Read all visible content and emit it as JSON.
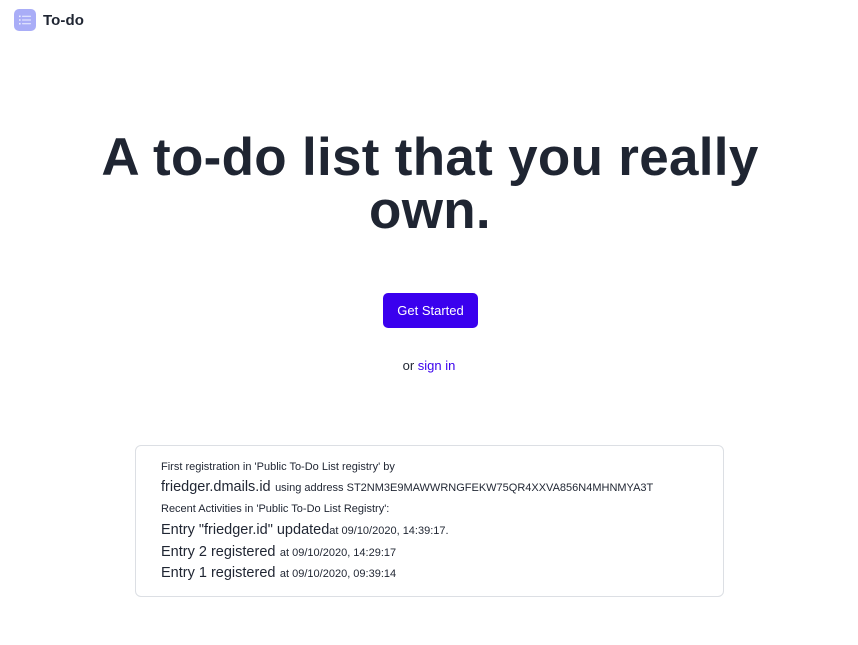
{
  "header": {
    "logo_icon": "list-icon",
    "title": "To-do"
  },
  "hero": {
    "title_line1": "A to-do list that you really",
    "title_line2": "own.",
    "cta_label": "Get Started",
    "signin_prefix": "or",
    "signin_link": "sign in"
  },
  "colors": {
    "accent": "#3a00ee",
    "logo_badge": "#a9adf7",
    "text": "#1f2532",
    "card_border": "#dcdfe4"
  },
  "registry": {
    "first_registration_label": "First registration in 'Public To-Do List registry' by",
    "owner_name": "friedger.dmails.id",
    "owner_address_text": "using address ST2NM3E9MAWWRNGFEKW75QR4XXVA856N4MHNMYA3T",
    "recent_label": "Recent Activities in 'Public To-Do List Registry':",
    "activities": [
      {
        "title": "Entry \"friedger.id\" updated",
        "time": "at 09/10/2020, 14:39:17."
      },
      {
        "title": "Entry 2 registered",
        "time": "at 09/10/2020, 14:29:17"
      },
      {
        "title": "Entry 1 registered",
        "time": "at 09/10/2020, 09:39:14"
      }
    ]
  }
}
